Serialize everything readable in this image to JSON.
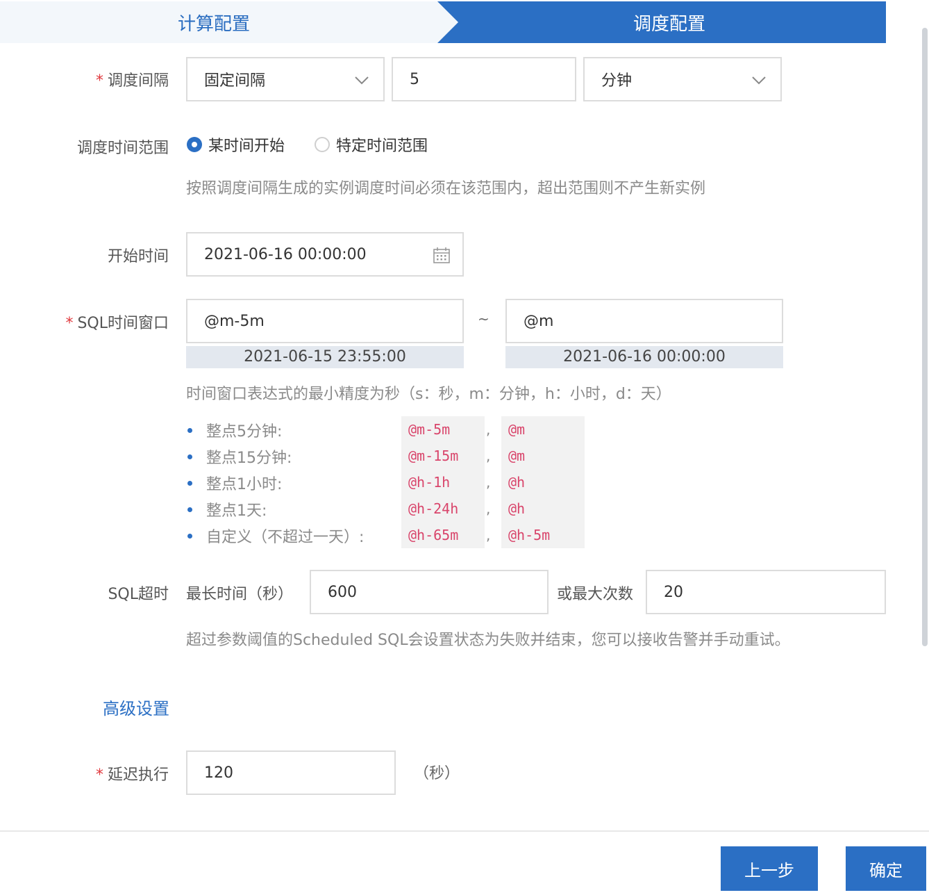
{
  "steps": {
    "step1": "计算配置",
    "step2": "调度配置"
  },
  "schedule_interval": {
    "label": "调度间隔",
    "type_value": "固定间隔",
    "number_value": "5",
    "unit_value": "分钟"
  },
  "time_range": {
    "label": "调度时间范围",
    "option1": "某时间开始",
    "option2": "特定时间范围",
    "selected": "某时间开始",
    "hint": "按照调度间隔生成的实例调度时间必须在该范围内，超出范围则不产生新实例"
  },
  "start_time": {
    "label": "开始时间",
    "value": "2021-06-16 00:00:00"
  },
  "sql_window": {
    "label": "SQL时间窗口",
    "from_value": "@m-5m",
    "to_value": "@m",
    "separator": "~",
    "from_preview": "2021-06-15 23:55:00",
    "to_preview": "2021-06-16 00:00:00",
    "hint": "时间窗口表达式的最小精度为秒（s：秒，m：分钟，h：小时，d：天）",
    "examples": [
      {
        "label": "整点5分钟:",
        "from": "@m-5m",
        "to": "@m"
      },
      {
        "label": "整点15分钟:",
        "from": "@m-15m",
        "to": "@m"
      },
      {
        "label": "整点1小时:",
        "from": "@h-1h",
        "to": "@h"
      },
      {
        "label": "整点1天:",
        "from": "@h-24h",
        "to": "@h"
      },
      {
        "label": "自定义（不超过一天）:",
        "from": "@h-65m",
        "to": "@h-5m"
      }
    ],
    "comma": ","
  },
  "sql_timeout": {
    "label": "SQL超时",
    "max_time_label": "最长时间（秒）",
    "max_time_value": "600",
    "max_count_label": "或最大次数",
    "max_count_value": "20",
    "hint": "超过参数阈值的Scheduled SQL会设置状态为失败并结束，您可以接收告警并手动重试。"
  },
  "advanced": {
    "label": "高级设置"
  },
  "delay": {
    "label": "延迟执行",
    "value": "120",
    "unit": "（秒）"
  },
  "footer": {
    "prev": "上一步",
    "confirm": "确定"
  },
  "colors": {
    "primary": "#2b6fc4",
    "required": "#e0393e",
    "code": "#d9456b"
  }
}
